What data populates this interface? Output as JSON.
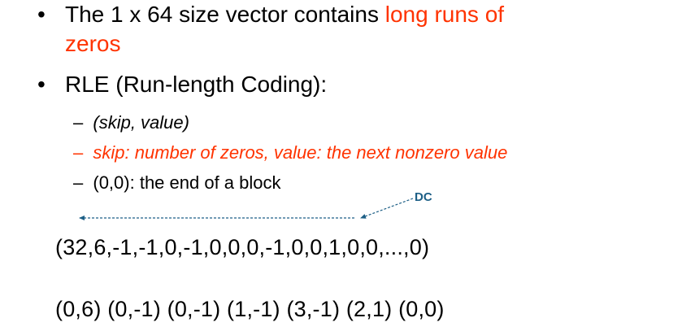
{
  "bullets": [
    {
      "line1_text": "The 1 x 64 size vector contains ",
      "line1_accent": "long runs of",
      "line2_accent": "zeros"
    },
    {
      "text": "RLE (Run-length Coding):"
    }
  ],
  "sub_items": [
    {
      "dash": "–",
      "text": "(skip, value)"
    },
    {
      "dash": "–",
      "text": "skip: number of zeros, value: the next nonzero value"
    },
    {
      "dash": "–",
      "text": "(0,0): the end of a block"
    }
  ],
  "annotation": {
    "label": "DC"
  },
  "sequence": "(32,6,-1,-1,0,-1,0,0,0,-1,0,0,1,0,0,...,0)",
  "encoded": "(0,6) (0,-1) (0,-1) (1,-1) (3,-1) (2,1) (0,0)",
  "colors": {
    "accent": "#ff3300",
    "annotation": "#1d5f86",
    "text": "#000000"
  }
}
